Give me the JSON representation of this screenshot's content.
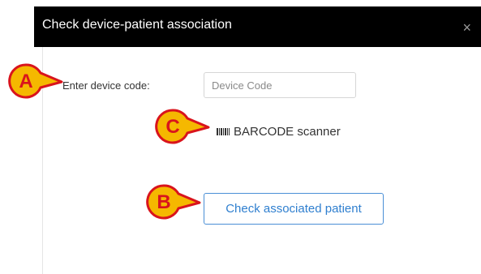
{
  "dialog": {
    "title": "Check device-patient association",
    "close_glyph": "×"
  },
  "form": {
    "device_code_label": "Enter device code:",
    "device_code_placeholder": "Device Code",
    "device_code_value": ""
  },
  "scanner": {
    "icon": "barcode-icon",
    "label": "BARCODE scanner"
  },
  "actions": {
    "check_label": "Check associated patient"
  },
  "callouts": {
    "a": "A",
    "b": "B",
    "c": "C"
  },
  "colors": {
    "header_bg": "#000000",
    "accent_blue": "#2f7fcf",
    "callout_fill": "#f5b800",
    "callout_border": "#d9141c",
    "callout_letter": "#d9141c"
  }
}
